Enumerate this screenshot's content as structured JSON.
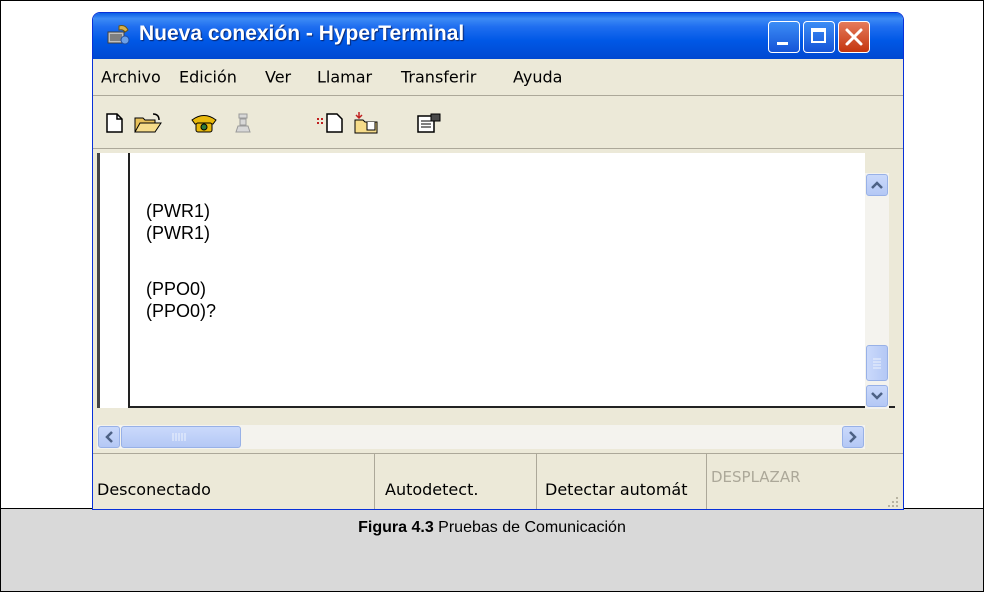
{
  "window": {
    "title": "Nueva conexión - HyperTerminal",
    "icon": "hyperterminal-icon",
    "controls": [
      "minimize-icon",
      "maximize-icon",
      "close-icon"
    ]
  },
  "menu": {
    "items": [
      "Archivo",
      "Edición",
      "Ver",
      "Llamar",
      "Transferir",
      "Ayuda"
    ]
  },
  "toolbar": {
    "icons": [
      "new-icon",
      "open-folder-icon",
      "call-icon",
      "disconnect-icon",
      "send-icon",
      "receive-icon",
      "properties-icon"
    ]
  },
  "terminal": {
    "lines": [
      "(PWR1)",
      "(PWR1)",
      "",
      "(PPO0)",
      "(PPO0)?"
    ]
  },
  "statusbar": {
    "connection": "Desconectado",
    "autodetect": "Autodetect.",
    "detect": "Detectar automát",
    "scroll": "DESPLAZAR"
  },
  "caption": {
    "label": "Figura 4.3",
    "text": "Pruebas de Comunicación"
  },
  "colors": {
    "titlebar": "#0058e6",
    "window_bg": "#ece9d8",
    "caption_bg": "#d9d9d9"
  }
}
